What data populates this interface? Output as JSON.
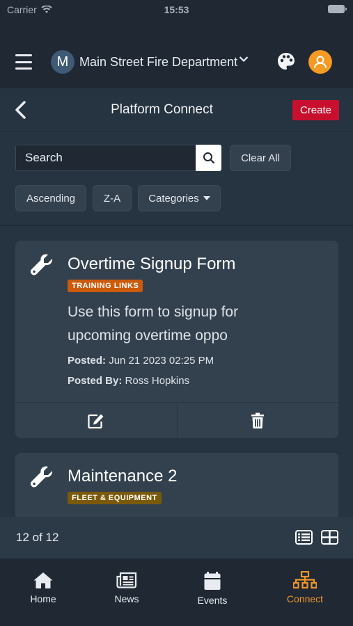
{
  "status": {
    "carrier": "Carrier",
    "time": "15:53"
  },
  "topbar": {
    "org_initial": "M",
    "org_name": "Main Street Fire Department"
  },
  "header": {
    "title": "Platform Connect",
    "create_label": "Create"
  },
  "filters": {
    "search_placeholder": "Search",
    "clear_label": "Clear All",
    "ascending_label": "Ascending",
    "sort_label": "Z-A",
    "categories_label": "Categories"
  },
  "cards": [
    {
      "title": "Overtime Signup Form",
      "tag": "TRAINING LINKS",
      "description": "Use this form to signup for upcoming overtime oppo",
      "posted_label": "Posted:",
      "posted_value": "Jun 21 2023 02:25 PM",
      "posted_by_label": "Posted By:",
      "posted_by_value": "Ross Hopkins"
    },
    {
      "title": "Maintenance 2",
      "tag": "FLEET & EQUIPMENT"
    }
  ],
  "pager": {
    "count": "12 of 12"
  },
  "tabs": [
    {
      "label": "Home"
    },
    {
      "label": "News"
    },
    {
      "label": "Events"
    },
    {
      "label": "Connect"
    }
  ],
  "colors": {
    "accent": "#f0962b",
    "create": "#c8102e",
    "tag_training": "#cc5a0b",
    "tag_fleet": "#7a5a0a"
  }
}
